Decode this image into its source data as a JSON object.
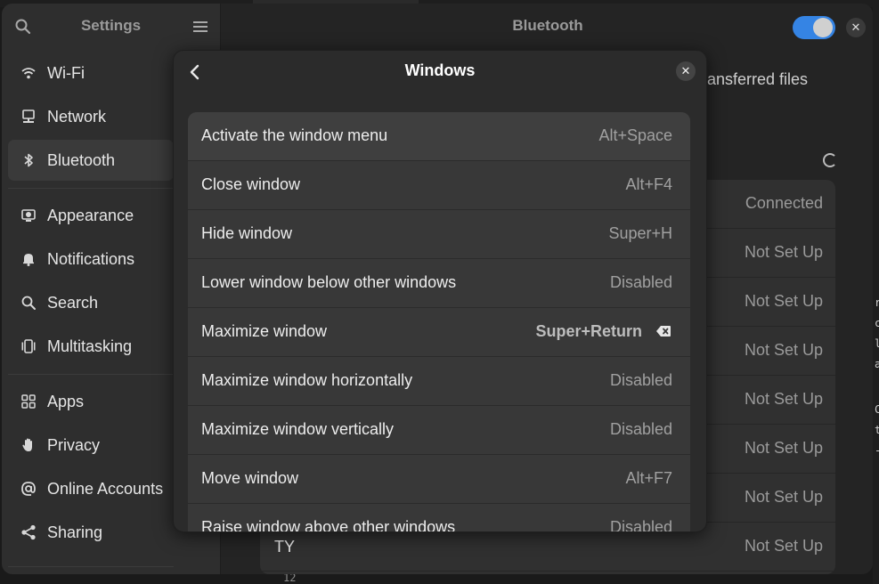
{
  "settings": {
    "sidebar_title": "Settings",
    "nav": [
      {
        "label": "Wi-Fi",
        "icon": "wifi-icon"
      },
      {
        "label": "Network",
        "icon": "network-icon"
      },
      {
        "label": "Bluetooth",
        "icon": "bluetooth-icon",
        "active": true
      },
      {
        "label": "Appearance",
        "icon": "appearance-icon"
      },
      {
        "label": "Notifications",
        "icon": "bell-icon"
      },
      {
        "label": "Search",
        "icon": "search-icon"
      },
      {
        "label": "Multitasking",
        "icon": "multitasking-icon"
      },
      {
        "label": "Apps",
        "icon": "apps-grid-icon"
      },
      {
        "label": "Privacy",
        "icon": "hand-icon"
      },
      {
        "label": "Online Accounts",
        "icon": "at-icon"
      },
      {
        "label": "Sharing",
        "icon": "share-icon"
      }
    ]
  },
  "bluetooth": {
    "title": "Bluetooth",
    "enabled": true,
    "transfer_text": "ransferred files",
    "devices": [
      {
        "name": "",
        "status": "Connected"
      },
      {
        "name": "",
        "status": "Not Set Up"
      },
      {
        "name": "",
        "status": "Not Set Up"
      },
      {
        "name": "",
        "status": "Not Set Up"
      },
      {
        "name": "",
        "status": "Not Set Up"
      },
      {
        "name": "",
        "status": "Not Set Up"
      },
      {
        "name": "",
        "status": "Not Set Up"
      },
      {
        "name": "TY",
        "status": "Not Set Up"
      }
    ]
  },
  "dialog": {
    "title": "Windows",
    "shortcuts": [
      {
        "label": "Activate the window menu",
        "accel": "Alt+Space"
      },
      {
        "label": "Close window",
        "accel": "Alt+F4"
      },
      {
        "label": "Hide window",
        "accel": "Super+H"
      },
      {
        "label": "Lower window below other windows",
        "accel": "Disabled"
      },
      {
        "label": "Maximize window",
        "accel": "Super+Return",
        "custom": true
      },
      {
        "label": "Maximize window horizontally",
        "accel": "Disabled"
      },
      {
        "label": "Maximize window vertically",
        "accel": "Disabled"
      },
      {
        "label": "Move window",
        "accel": "Alt+F7"
      },
      {
        "label": "Raise window above other windows",
        "accel": "Disabled"
      }
    ]
  },
  "background_editor": {
    "line_number": "12",
    "right_chars": [
      "r",
      "c",
      "l",
      "a",
      "C",
      "t",
      "-"
    ]
  },
  "colors": {
    "accent": "#3584e4"
  }
}
